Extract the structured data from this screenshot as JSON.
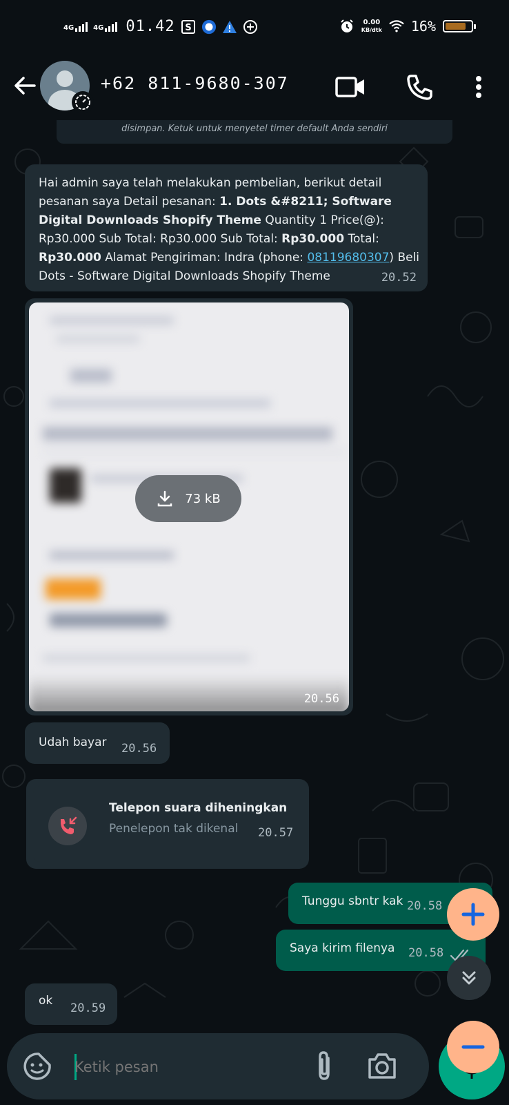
{
  "status_bar": {
    "net1": "4G",
    "net2": "4G",
    "time": "01.42",
    "speed_value": "0.00",
    "speed_unit": "KB/dtk",
    "battery_pct": "16%",
    "battery_level": 0.16
  },
  "header": {
    "contact": "+62 811-9680-307"
  },
  "chat": {
    "system_notice": "disimpan. Ketuk untuk menyetel timer default Anda sendiri",
    "msg1": {
      "p1": "Hai admin saya telah melakukan pembelian, berikut detail pesanan saya Detail pesanan: ",
      "b1": "1. Dots &#8211; Software Digital Downloads Shopify Theme",
      "p2": " Quantity 1 Price(@): Rp30.000 Sub Total: Rp30.000 Sub Total: ",
      "b2": "Rp30.000",
      "p3": " Total: ",
      "b3": "Rp30.000",
      "p4": " Alamat Pengiriman: Indra (phone: ",
      "phone": "08119680307",
      "p5": ") Beli Dots - Software Digital Downloads Shopify Theme",
      "time": "20.52"
    },
    "image": {
      "size": "73 kB",
      "time": "20.56"
    },
    "msg2": {
      "text": "Udah bayar",
      "time": "20.56"
    },
    "call": {
      "title": "Telepon suara diheningkan",
      "subtitle": "Penelepon tak dikenal",
      "time": "20.57"
    },
    "out1": {
      "text": "Tunggu sbntr kak",
      "time": "20.58"
    },
    "out2": {
      "text": "Saya kirim filenya",
      "time": "20.58"
    },
    "msg3": {
      "text": "ok",
      "time": "20.59"
    }
  },
  "input": {
    "placeholder": "Ketik pesan"
  },
  "colors": {
    "background": "#0b1014",
    "incoming": "#202c33",
    "outgoing": "#005c4b",
    "accent": "#00a884",
    "fab": "#ffb48a"
  }
}
